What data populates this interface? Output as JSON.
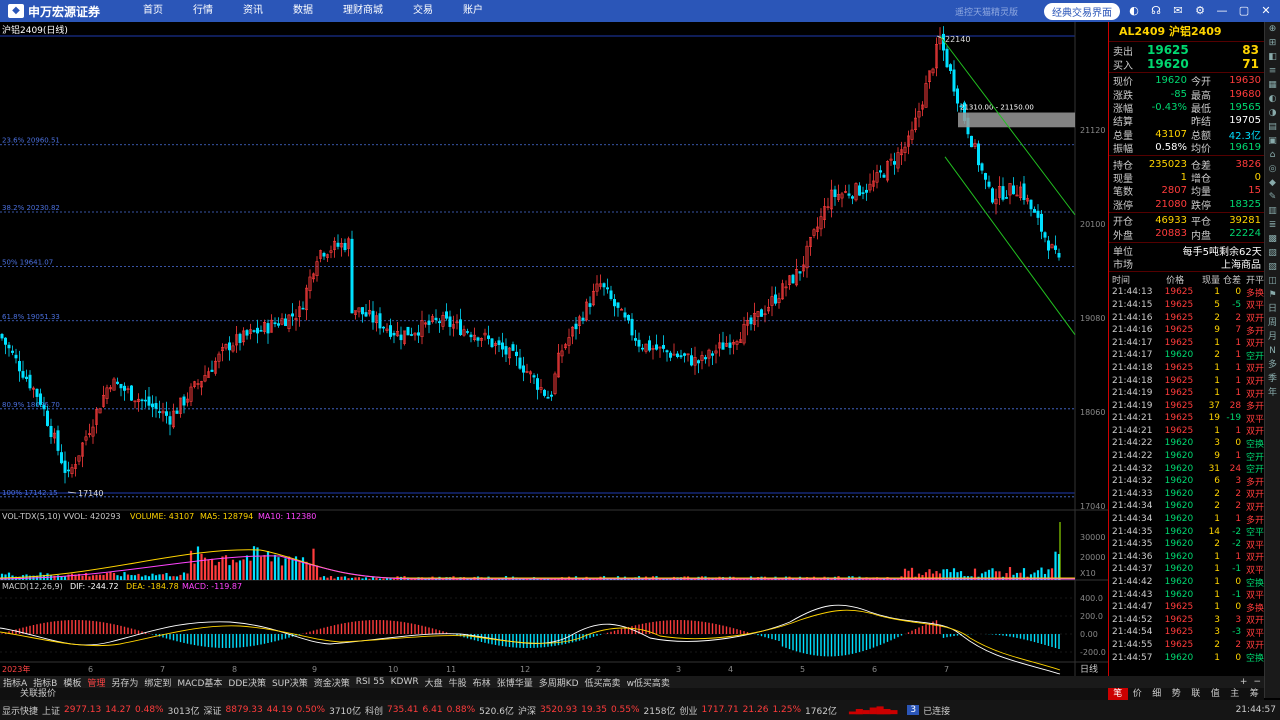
{
  "topbar": {
    "logo": "申万宏源证券",
    "nav": [
      "首页",
      "行情",
      "资讯",
      "数据",
      "理财商城",
      "交易",
      "账户"
    ],
    "faint": "遥控天猫精灵版",
    "classic": "经典交易界面",
    "icons": [
      "theme-icon",
      "headset-icon",
      "mail-icon",
      "gear-icon",
      "minimize-icon",
      "maximize-icon",
      "close-icon"
    ]
  },
  "chart": {
    "title": "沪铝2409(日线)",
    "high_label": "22140",
    "low_label": "17140",
    "band_label": "21310.00 - 21150.00",
    "fib": [
      {
        "label": "23.6% 20960.51"
      },
      {
        "label": "38.2% 20230.82"
      },
      {
        "label": "50% 19641.07"
      },
      {
        "label": "61.8% 19051.33"
      },
      {
        "label": "80.9% 18096.70"
      },
      {
        "label": "100% 17142.15"
      }
    ],
    "yticks": [
      "21120",
      "20100",
      "19080",
      "18060",
      "17040"
    ],
    "vol_title": "VOL-TDX(5,10) VVOL: 420293",
    "vol_volume": "VOLUME: 43107",
    "vol_ma5": "MA5: 128794",
    "vol_ma10": "MA10: 112380",
    "vol_ticks": [
      "30000",
      "20000",
      "X10"
    ],
    "macd_title": "MACD(12,26,9)",
    "macd_dif": "DIF: -244.72",
    "macd_dea": "DEA: -184.78",
    "macd_val": "MACD: -119.87",
    "macd_ticks": [
      "400.0",
      "200.0",
      "0.00",
      "-200.0"
    ],
    "xlabels": [
      "2023年",
      "6",
      "7",
      "8",
      "9",
      "10",
      "11",
      "12",
      "2",
      "3",
      "4",
      "5",
      "6",
      "7"
    ],
    "period": "日线"
  },
  "quote": {
    "header": "AL2409 沪铝2409",
    "sell": {
      "label": "卖出",
      "price": "19625",
      "vol": "83"
    },
    "buy": {
      "label": "买入",
      "price": "19620",
      "vol": "71"
    },
    "rows": [
      [
        [
          "现价",
          "19620",
          "grn"
        ],
        [
          "今开",
          "19630",
          "red"
        ]
      ],
      [
        [
          "涨跌",
          "-85",
          "grn"
        ],
        [
          "最高",
          "19680",
          "red"
        ]
      ],
      [
        [
          "涨幅",
          "-0.43%",
          "grn"
        ],
        [
          "最低",
          "19565",
          "grn"
        ]
      ],
      [
        [
          "结算",
          "",
          ""
        ],
        [
          "昨结",
          "19705",
          "wht"
        ]
      ],
      [
        [
          "总量",
          "43107",
          "yel"
        ],
        [
          "总额",
          "42.3亿",
          "cyn"
        ]
      ],
      [
        [
          "振幅",
          "0.58%",
          "wht"
        ],
        [
          "均价",
          "19619",
          "grn"
        ]
      ]
    ],
    "rows2": [
      [
        [
          "持仓",
          "235023",
          "yel"
        ],
        [
          "仓差",
          "3826",
          "red"
        ]
      ],
      [
        [
          "现量",
          "1",
          "yel"
        ],
        [
          "增仓",
          "0",
          "yel"
        ]
      ],
      [
        [
          "笔数",
          "2807",
          "red"
        ],
        [
          "均量",
          "15",
          "red"
        ]
      ],
      [
        [
          "涨停",
          "21080",
          "red"
        ],
        [
          "跌停",
          "18325",
          "grn"
        ]
      ]
    ],
    "rows3": [
      [
        [
          "开仓",
          "46933",
          "yel"
        ],
        [
          "平仓",
          "39281",
          "yel"
        ]
      ],
      [
        [
          "外盘",
          "20883",
          "red"
        ],
        [
          "内盘",
          "22224",
          "grn"
        ]
      ]
    ],
    "unit": {
      "label": "单位",
      "value": "每手5吨",
      "remain": "剩余62天"
    },
    "market": {
      "label": "市场",
      "value": "上海商品"
    },
    "tick_header": [
      "时间",
      "价格",
      "现量",
      "仓差",
      "开平"
    ],
    "ticks": [
      [
        "21:44:13",
        "19625",
        "1",
        "0",
        "多换"
      ],
      [
        "21:44:15",
        "19625",
        "5",
        "-5",
        "双平"
      ],
      [
        "21:44:16",
        "19625",
        "2",
        "2",
        "双开"
      ],
      [
        "21:44:16",
        "19625",
        "9",
        "7",
        "多开"
      ],
      [
        "21:44:17",
        "19625",
        "1",
        "1",
        "双开"
      ],
      [
        "21:44:17",
        "19620",
        "2",
        "1",
        "空开"
      ],
      [
        "21:44:18",
        "19625",
        "1",
        "1",
        "双开"
      ],
      [
        "21:44:18",
        "19625",
        "1",
        "1",
        "双开"
      ],
      [
        "21:44:19",
        "19625",
        "1",
        "1",
        "双开"
      ],
      [
        "21:44:19",
        "19625",
        "37",
        "28",
        "多开"
      ],
      [
        "21:44:21",
        "19625",
        "19",
        "-19",
        "双平"
      ],
      [
        "21:44:21",
        "19625",
        "1",
        "1",
        "双开"
      ],
      [
        "21:44:22",
        "19620",
        "3",
        "0",
        "空换"
      ],
      [
        "21:44:22",
        "19620",
        "9",
        "1",
        "空开"
      ],
      [
        "21:44:32",
        "19620",
        "31",
        "24",
        "空开"
      ],
      [
        "21:44:32",
        "19620",
        "6",
        "3",
        "多开"
      ],
      [
        "21:44:33",
        "19620",
        "2",
        "2",
        "双开"
      ],
      [
        "21:44:34",
        "19620",
        "2",
        "2",
        "双开"
      ],
      [
        "21:44:34",
        "19620",
        "1",
        "1",
        "多开"
      ],
      [
        "21:44:35",
        "19620",
        "14",
        "-2",
        "空平"
      ],
      [
        "21:44:35",
        "19620",
        "2",
        "-2",
        "双平"
      ],
      [
        "21:44:36",
        "19620",
        "1",
        "1",
        "双开"
      ],
      [
        "21:44:37",
        "19620",
        "1",
        "-1",
        "双平"
      ],
      [
        "21:44:42",
        "19620",
        "1",
        "0",
        "空换"
      ],
      [
        "21:44:43",
        "19620",
        "1",
        "-1",
        "双平"
      ],
      [
        "21:44:47",
        "19625",
        "1",
        "0",
        "多换"
      ],
      [
        "21:44:52",
        "19625",
        "3",
        "3",
        "双开"
      ],
      [
        "21:44:54",
        "19625",
        "3",
        "-3",
        "双平"
      ],
      [
        "21:44:55",
        "19625",
        "2",
        "2",
        "双开"
      ],
      [
        "21:44:57",
        "19620",
        "1",
        "0",
        "空换"
      ]
    ],
    "tabs": [
      "笔",
      "价",
      "细",
      "势",
      "联",
      "值",
      "主",
      "筹"
    ]
  },
  "indicators": [
    "指标A",
    "指标B",
    "模板",
    "管理",
    "另存为",
    "绑定到",
    "MACD基本",
    "DDE决策",
    "SUP决策",
    "资金决策",
    "RSI 55",
    "KDWR",
    "大盘",
    "牛股",
    "布林",
    "张博华量",
    "多周期KD",
    "低买高卖",
    "w低买高卖"
  ],
  "bottom2": "关联报价",
  "status": {
    "show": "显示快捷",
    "sh": {
      "label": "上证",
      "value": "2977.13",
      "chg": "14.27",
      "pct": "0.48%",
      "amt": "3013亿"
    },
    "sz": {
      "label": "深证",
      "value": "8879.33",
      "chg": "44.19",
      "pct": "0.50%",
      "amt": "3710亿"
    },
    "kc": {
      "label": "科创",
      "value": "735.41",
      "chg": "6.41",
      "pct": "0.88%",
      "amt": "520.6亿"
    },
    "hs": {
      "label": "沪深",
      "value": "3520.93",
      "chg": "19.35",
      "pct": "0.55%",
      "amt": "2158亿"
    },
    "cy": {
      "label": "创业",
      "value": "1717.71",
      "chg": "21.26",
      "pct": "1.25%",
      "amt": "1762亿"
    },
    "conn": "已连接",
    "time": "21:44:57"
  },
  "strip": [
    "⊕",
    "⊞",
    "◧",
    "≡",
    "▦",
    "◐",
    "◑",
    "▤",
    "▣",
    "⌂",
    "◎",
    "◆",
    "✎",
    "▥",
    "≣",
    "▩",
    "▨",
    "▧",
    "◫",
    "⚑",
    "日",
    "周",
    "月",
    "N",
    "多",
    "季",
    "年"
  ],
  "colors": {
    "up": "#ff3c3c",
    "down": "#00e0ff",
    "grid": "#1e3ab0",
    "fib": "#4a6fdc"
  }
}
